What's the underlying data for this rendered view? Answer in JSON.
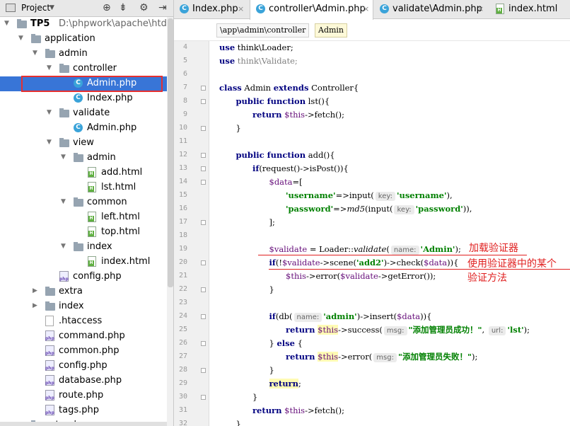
{
  "project_panel": {
    "title": "Project",
    "tree": [
      {
        "label": "TP5",
        "path": "D:\\phpwork\\apache\\htdocs\\T",
        "type": "root",
        "depth": 0,
        "expanded": true
      },
      {
        "label": "application",
        "type": "folder",
        "depth": 1,
        "expanded": true
      },
      {
        "label": "admin",
        "type": "folder",
        "depth": 2,
        "expanded": true
      },
      {
        "label": "controller",
        "type": "folder",
        "depth": 3,
        "expanded": true
      },
      {
        "label": "Admin.php",
        "type": "class",
        "depth": 4,
        "selected": true
      },
      {
        "label": "Index.php",
        "type": "class",
        "depth": 4
      },
      {
        "label": "validate",
        "type": "folder",
        "depth": 3,
        "expanded": true
      },
      {
        "label": "Admin.php",
        "type": "class",
        "depth": 4
      },
      {
        "label": "view",
        "type": "folder",
        "depth": 3,
        "expanded": true
      },
      {
        "label": "admin",
        "type": "folder",
        "depth": 4,
        "expanded": true
      },
      {
        "label": "add.html",
        "type": "html",
        "depth": 5
      },
      {
        "label": "lst.html",
        "type": "html",
        "depth": 5
      },
      {
        "label": "common",
        "type": "folder",
        "depth": 4,
        "expanded": true
      },
      {
        "label": "left.html",
        "type": "html",
        "depth": 5
      },
      {
        "label": "top.html",
        "type": "html",
        "depth": 5
      },
      {
        "label": "index",
        "type": "folder",
        "depth": 4,
        "expanded": true
      },
      {
        "label": "index.html",
        "type": "html",
        "depth": 5
      },
      {
        "label": "config.php",
        "type": "php",
        "depth": 3
      },
      {
        "label": "extra",
        "type": "folder",
        "depth": 2,
        "expanded": false
      },
      {
        "label": "index",
        "type": "folder",
        "depth": 2,
        "expanded": false
      },
      {
        "label": ".htaccess",
        "type": "file",
        "depth": 2
      },
      {
        "label": "command.php",
        "type": "php",
        "depth": 2
      },
      {
        "label": "common.php",
        "type": "php",
        "depth": 2
      },
      {
        "label": "config.php",
        "type": "php",
        "depth": 2
      },
      {
        "label": "database.php",
        "type": "php",
        "depth": 2
      },
      {
        "label": "route.php",
        "type": "php",
        "depth": 2
      },
      {
        "label": "tags.php",
        "type": "php",
        "depth": 2
      },
      {
        "label": "extend",
        "type": "folder",
        "depth": 1,
        "expanded": false
      }
    ]
  },
  "tabs": [
    {
      "label": "Index.php",
      "icon": "class-icon",
      "active": false
    },
    {
      "label": "controller\\Admin.php",
      "icon": "class-icon",
      "active": true
    },
    {
      "label": "validate\\Admin.php",
      "icon": "class-icon",
      "active": false
    },
    {
      "label": "index.html",
      "icon": "html-file-icon",
      "active": false
    }
  ],
  "breadcrumb": [
    "\\app\\admin\\controller",
    "Admin"
  ],
  "editor": {
    "lines": [
      {
        "n": 4,
        "segs": [
          [
            "kw",
            "use"
          ],
          [
            "",
            " think\\Loader;"
          ]
        ]
      },
      {
        "n": 5,
        "segs": [
          [
            "kw",
            "use"
          ],
          [
            "gray",
            " think\\Validate;"
          ]
        ]
      },
      {
        "n": 6,
        "segs": []
      },
      {
        "n": 7,
        "segs": [
          [
            "kw",
            "class"
          ],
          [
            "",
            " Admin "
          ],
          [
            "kw",
            "extends"
          ],
          [
            "",
            " Controller{"
          ]
        ]
      },
      {
        "n": 8,
        "indent": 1,
        "segs": [
          [
            "kw",
            "public function"
          ],
          [
            "",
            " lst(){"
          ]
        ]
      },
      {
        "n": 9,
        "indent": 2,
        "segs": [
          [
            "kw",
            "return"
          ],
          [
            "",
            " "
          ],
          [
            "var",
            "$this"
          ],
          [
            "",
            "->fetch();"
          ]
        ]
      },
      {
        "n": 10,
        "indent": 1,
        "segs": [
          [
            "",
            "}"
          ]
        ]
      },
      {
        "n": 11,
        "segs": []
      },
      {
        "n": 12,
        "indent": 1,
        "segs": [
          [
            "kw",
            "public function"
          ],
          [
            "",
            " add(){"
          ]
        ]
      },
      {
        "n": 13,
        "indent": 2,
        "segs": [
          [
            "kw",
            "if"
          ],
          [
            "",
            "(request()->isPost()){"
          ]
        ]
      },
      {
        "n": 14,
        "indent": 3,
        "segs": [
          [
            "var",
            "$data"
          ],
          [
            "",
            "=["
          ]
        ]
      },
      {
        "n": 15,
        "indent": 4,
        "segs": [
          [
            "str",
            "'username'"
          ],
          [
            "",
            "=>input("
          ],
          [
            "hint",
            "key:"
          ],
          [
            "str",
            "'username'"
          ],
          [
            "",
            "),"
          ]
        ]
      },
      {
        "n": 16,
        "indent": 4,
        "segs": [
          [
            "str",
            "'password'"
          ],
          [
            "",
            "=>"
          ],
          [
            "it",
            "md5"
          ],
          [
            "",
            "(input("
          ],
          [
            "hint",
            "key:"
          ],
          [
            "str",
            "'password'"
          ],
          [
            "",
            ")),"
          ]
        ]
      },
      {
        "n": 17,
        "indent": 3,
        "segs": [
          [
            "",
            "];"
          ]
        ]
      },
      {
        "n": 18,
        "segs": []
      },
      {
        "n": 19,
        "indent": 3,
        "segs": [
          [
            "var",
            "$validate"
          ],
          [
            "",
            " = Loader::"
          ],
          [
            "it",
            "validate"
          ],
          [
            "",
            "("
          ],
          [
            "hint",
            "name:"
          ],
          [
            "str",
            "'Admin'"
          ],
          [
            "",
            ");"
          ]
        ]
      },
      {
        "n": 20,
        "indent": 3,
        "segs": [
          [
            "kw",
            "if"
          ],
          [
            "",
            "(!"
          ],
          [
            "var",
            "$validate"
          ],
          [
            "",
            "->scene("
          ],
          [
            "str",
            "'add2'"
          ],
          [
            "",
            ")->check("
          ],
          [
            "var",
            "$data"
          ],
          [
            "",
            ")){"
          ]
        ]
      },
      {
        "n": 21,
        "indent": 4,
        "segs": [
          [
            "var",
            "$this"
          ],
          [
            "",
            "->error("
          ],
          [
            "var",
            "$validate"
          ],
          [
            "",
            "->getError());"
          ]
        ]
      },
      {
        "n": 22,
        "indent": 3,
        "segs": [
          [
            "",
            "}"
          ]
        ]
      },
      {
        "n": 23,
        "segs": []
      },
      {
        "n": 24,
        "indent": 3,
        "segs": [
          [
            "kw",
            "if"
          ],
          [
            "",
            "(db("
          ],
          [
            "hint",
            "name:"
          ],
          [
            "str",
            "'admin'"
          ],
          [
            "",
            ")->insert("
          ],
          [
            "var",
            "$data"
          ],
          [
            "",
            ")){"
          ]
        ]
      },
      {
        "n": 25,
        "indent": 4,
        "segs": [
          [
            "kw",
            "return"
          ],
          [
            "",
            " "
          ],
          [
            "yvar",
            "$this"
          ],
          [
            "",
            "->success("
          ],
          [
            "hint",
            "msg:"
          ],
          [
            "str",
            "\"添加管理员成功！\""
          ],
          [
            "",
            ", "
          ],
          [
            "hint",
            "url:"
          ],
          [
            "str",
            "'lst'"
          ],
          [
            "",
            ");"
          ]
        ]
      },
      {
        "n": 26,
        "indent": 3,
        "segs": [
          [
            "",
            "} "
          ],
          [
            "kw",
            "else"
          ],
          [
            "",
            " {"
          ]
        ]
      },
      {
        "n": 27,
        "indent": 4,
        "segs": [
          [
            "kw",
            "return"
          ],
          [
            "",
            " "
          ],
          [
            "yvar",
            "$this"
          ],
          [
            "",
            "->error("
          ],
          [
            "hint",
            "msg:"
          ],
          [
            "str",
            "\"添加管理员失败！\""
          ],
          [
            "",
            ");"
          ]
        ]
      },
      {
        "n": 28,
        "indent": 3,
        "segs": [
          [
            "",
            "}"
          ]
        ]
      },
      {
        "n": 29,
        "indent": 3,
        "segs": [
          [
            "ykw",
            "return"
          ],
          [
            "",
            ";"
          ]
        ]
      },
      {
        "n": 30,
        "indent": 2,
        "segs": [
          [
            "",
            "}"
          ]
        ]
      },
      {
        "n": 31,
        "indent": 2,
        "segs": [
          [
            "kw",
            "return"
          ],
          [
            "",
            " "
          ],
          [
            "var",
            "$this"
          ],
          [
            "",
            "->fetch();"
          ]
        ]
      },
      {
        "n": 32,
        "indent": 1,
        "segs": [
          [
            "",
            "}"
          ]
        ]
      }
    ]
  },
  "annotations": {
    "load_validator": "加载验证器",
    "use_method_line1": "使用验证器中的某个",
    "use_method_line2": "验证方法"
  },
  "colors": {
    "selection": "#3875d7",
    "red_highlight": "#e53030",
    "keyword": "#000080",
    "variable": "#660e7a",
    "string": "#008000"
  }
}
